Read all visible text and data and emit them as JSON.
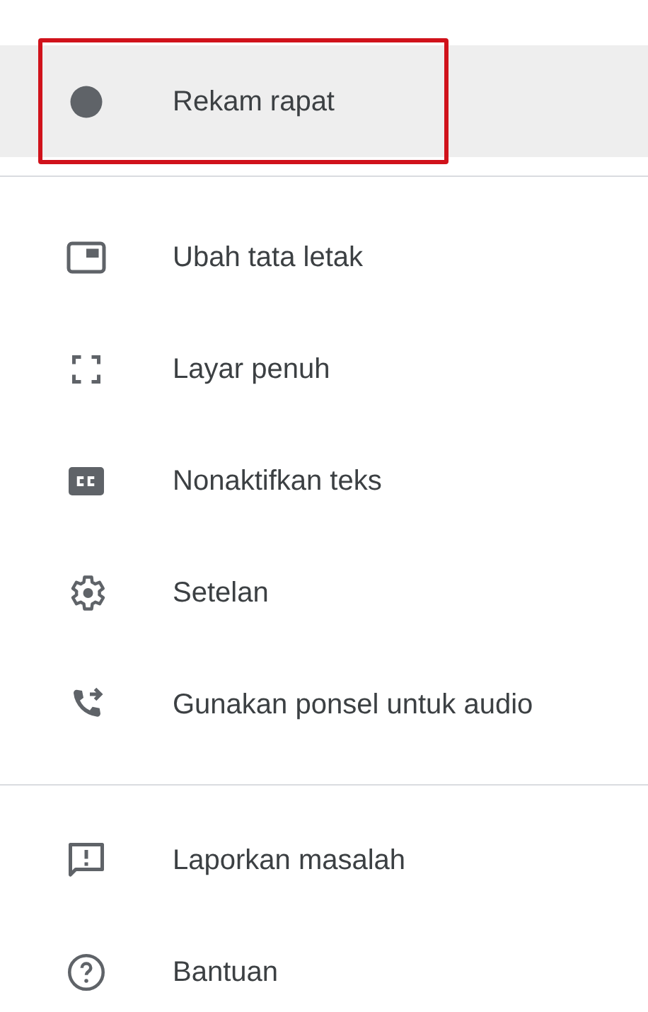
{
  "menu": {
    "sections": [
      {
        "items": [
          {
            "kind": "record",
            "label": "Rekam rapat",
            "selected": true,
            "highlighted": true
          }
        ]
      },
      {
        "items": [
          {
            "kind": "layout",
            "label": "Ubah tata letak",
            "selected": false,
            "highlighted": false
          },
          {
            "kind": "fullscreen",
            "label": "Layar penuh",
            "selected": false,
            "highlighted": false
          },
          {
            "kind": "captions",
            "label": "Nonaktifkan teks",
            "selected": false,
            "highlighted": false
          },
          {
            "kind": "settings",
            "label": "Setelan",
            "selected": false,
            "highlighted": false
          },
          {
            "kind": "phone-audio",
            "label": "Gunakan ponsel untuk audio",
            "selected": false,
            "highlighted": false
          }
        ]
      },
      {
        "items": [
          {
            "kind": "report",
            "label": "Laporkan masalah",
            "selected": false,
            "highlighted": false
          },
          {
            "kind": "help",
            "label": "Bantuan",
            "selected": false,
            "highlighted": false
          }
        ]
      }
    ]
  }
}
